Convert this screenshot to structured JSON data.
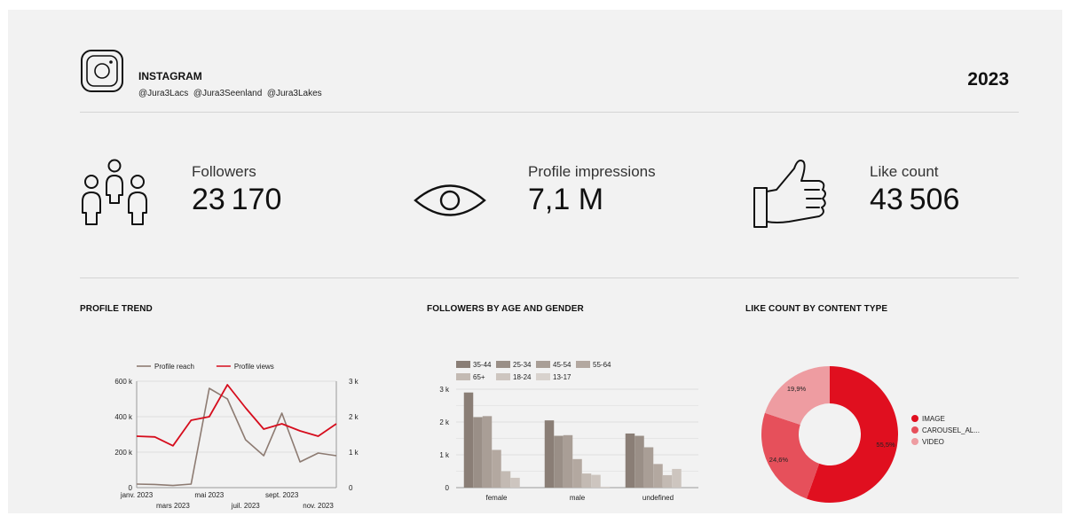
{
  "header": {
    "platform": "INSTAGRAM",
    "handles": "@Jura3Lacs  @Jura3Seenland  @Jura3Lakes",
    "year": "2023"
  },
  "kpis": {
    "followers": {
      "label": "Followers",
      "value": "23 170"
    },
    "impressions": {
      "label": "Profile impressions",
      "value": "7,1 M"
    },
    "likes": {
      "label": "Like count",
      "value": "43 506"
    }
  },
  "sections": {
    "trend_title": "PROFILE TREND",
    "age_title": "FOLLOWERS BY AGE AND GENDER",
    "like_title": "LIKE COUNT BY CONTENT TYPE"
  },
  "chart_data": [
    {
      "type": "line",
      "x": [
        "janv. 2023",
        "févr. 2023",
        "mars 2023",
        "avr. 2023",
        "mai 2023",
        "juin 2023",
        "juil. 2023",
        "août 2023",
        "sept. 2023",
        "oct. 2023",
        "nov. 2023",
        "déc. 2023"
      ],
      "x_tick_labels": [
        "janv. 2023",
        "mars 2023",
        "mai 2023",
        "juil. 2023",
        "sept. 2023",
        "nov. 2023"
      ],
      "series": [
        {
          "name": "Profile reach",
          "axis": "left",
          "color": "#8d7b72",
          "values": [
            20000,
            18000,
            12000,
            20000,
            560000,
            500000,
            270000,
            180000,
            420000,
            145000,
            195000,
            180000
          ]
        },
        {
          "name": "Profile views",
          "axis": "right",
          "color": "#d60d1d",
          "values": [
            1450,
            1430,
            1180,
            1900,
            2000,
            2900,
            2250,
            1650,
            1800,
            1600,
            1450,
            1800
          ]
        }
      ],
      "ylim_left": [
        0,
        600000
      ],
      "ylim_right": [
        0,
        3000
      ],
      "yticks_left": [
        "0",
        "200 k",
        "400 k",
        "600 k"
      ],
      "yticks_right": [
        "0",
        "1 k",
        "2 k",
        "3 k"
      ],
      "legend": "top"
    },
    {
      "type": "bar",
      "categories": [
        "female",
        "male",
        "undefined"
      ],
      "series": [
        {
          "name": "35-44",
          "color": "#8a7e76",
          "values": [
            2900,
            2050,
            1650
          ]
        },
        {
          "name": "25-34",
          "color": "#9a8f87",
          "values": [
            2150,
            1580,
            1580
          ]
        },
        {
          "name": "45-54",
          "color": "#a99e96",
          "values": [
            2180,
            1600,
            1230
          ]
        },
        {
          "name": "55-64",
          "color": "#b3a8a0",
          "values": [
            1150,
            870,
            720
          ]
        },
        {
          "name": "65+",
          "color": "#c3bab3",
          "values": [
            500,
            430,
            380
          ]
        },
        {
          "name": "18-24",
          "color": "#cdc5bf",
          "values": [
            300,
            390,
            570
          ]
        },
        {
          "name": "13-17",
          "color": "#d8d2cd",
          "values": [
            0,
            30,
            0
          ]
        }
      ],
      "ylim": [
        0,
        3000
      ],
      "yticks": [
        "0",
        "1 k",
        "2 k",
        "3 k"
      ],
      "legend": "top"
    },
    {
      "type": "pie",
      "donut": true,
      "categories": [
        "IMAGE",
        "CAROUSEL_AL...",
        "VIDEO"
      ],
      "values": [
        55.5,
        24.6,
        19.9
      ],
      "labels": [
        "55,5%",
        "24,6%",
        "19,9%"
      ],
      "colors": [
        "#e00f1f",
        "#e6505b",
        "#ee9ca1"
      ],
      "legend": "right"
    }
  ]
}
